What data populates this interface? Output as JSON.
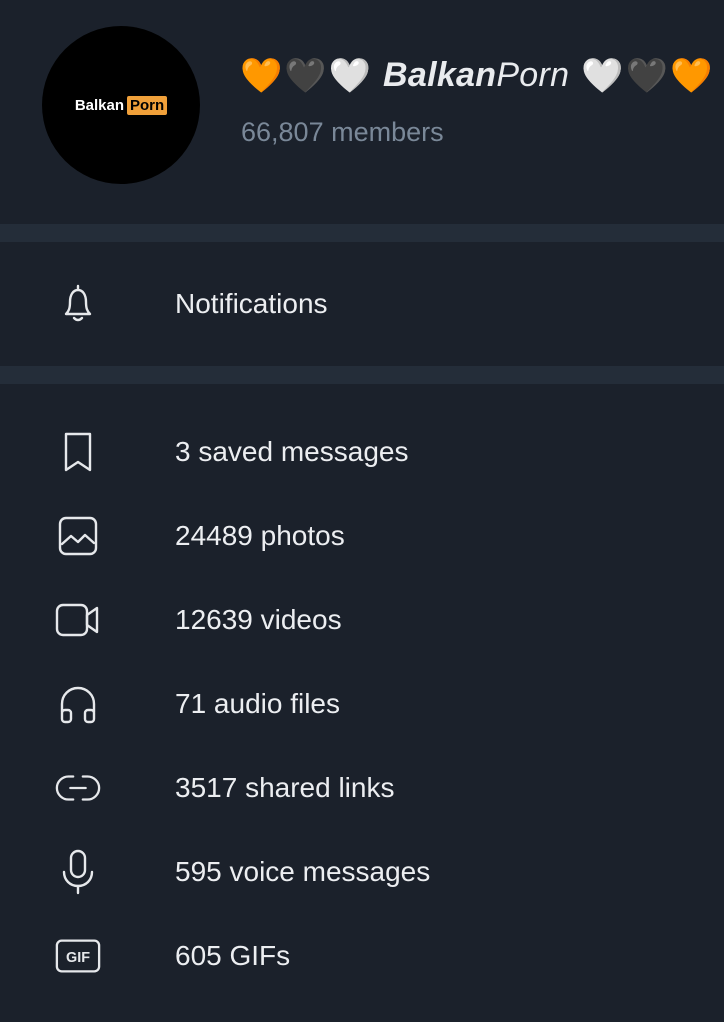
{
  "group": {
    "avatar": {
      "text_left": "Balkan",
      "text_tag": "Porn"
    },
    "title_prefix_hearts": [
      "🧡",
      "🖤",
      "🤍"
    ],
    "title_bold": "Balkan",
    "title_light": "Porn",
    "title_suffix_hearts": [
      "🤍",
      "🖤",
      "🧡"
    ],
    "members": "66,807 members"
  },
  "notifications": {
    "label": "Notifications",
    "icon": "bell-icon"
  },
  "media_items": [
    {
      "icon": "bookmark-icon",
      "label": "3 saved messages"
    },
    {
      "icon": "photo-icon",
      "label": "24489 photos"
    },
    {
      "icon": "video-icon",
      "label": "12639 videos"
    },
    {
      "icon": "headphones-icon",
      "label": "71 audio files"
    },
    {
      "icon": "link-icon",
      "label": "3517 shared links"
    },
    {
      "icon": "microphone-icon",
      "label": "595 voice messages"
    },
    {
      "icon": "gif-icon",
      "label": "605 GIFs",
      "icon_text": "GIF"
    }
  ],
  "colors": {
    "background": "#1b212b",
    "divider": "#242d39",
    "secondary_text": "#7a8898",
    "avatar_tag": "#f0a03a"
  }
}
